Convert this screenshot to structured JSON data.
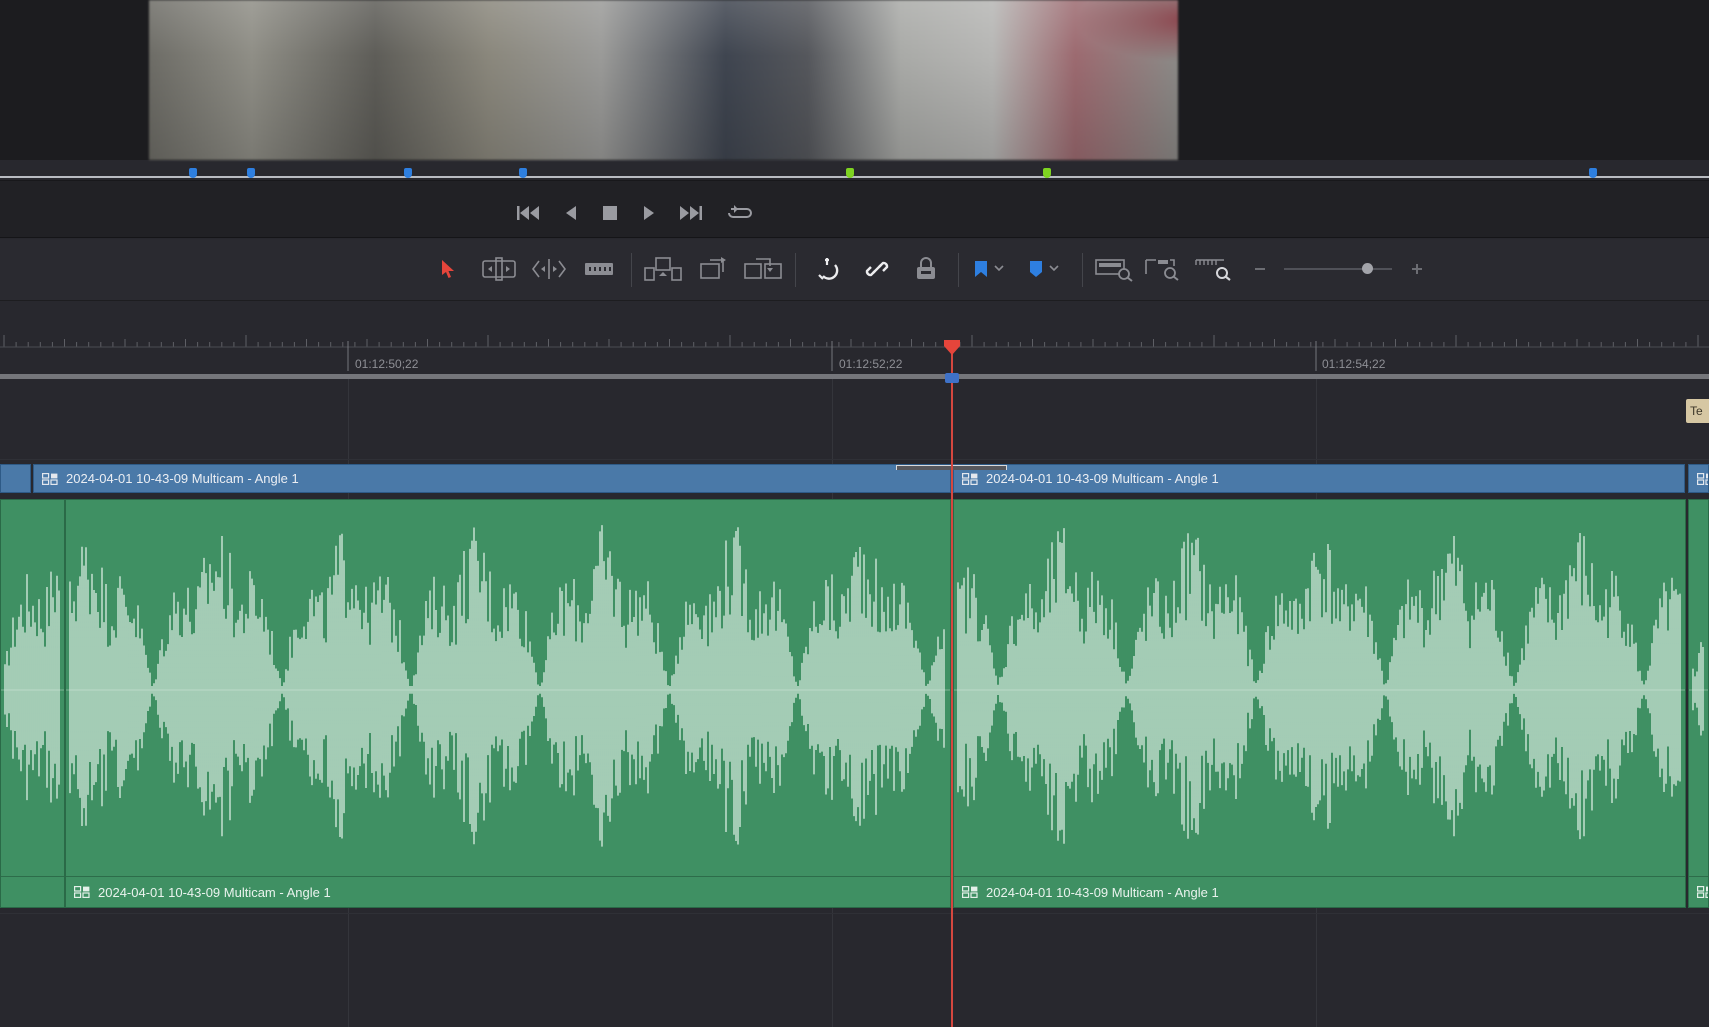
{
  "viewer": {
    "markers": [
      {
        "color": "#2e7fe0"
      },
      {
        "color": "#2e7fe0"
      },
      {
        "color": "#2e7fe0"
      },
      {
        "color": "#2e7fe0"
      },
      {
        "color": "#7ed321"
      },
      {
        "color": "#7ed321"
      },
      {
        "color": "#2e7fe0"
      }
    ]
  },
  "transport": {
    "buttons": [
      "skip-to-start-icon",
      "play-reverse-icon",
      "stop-icon",
      "play-icon",
      "skip-to-end-icon",
      "loop-icon"
    ]
  },
  "toolbar": {
    "tools": [
      "selection-mode-icon",
      "trim-edit-mode-icon",
      "dynamic-trim-mode-icon",
      "blade-edit-mode-icon",
      "insert-clip-icon",
      "overwrite-clip-icon",
      "replace-clip-icon",
      "snapping-icon",
      "linked-selection-icon",
      "position-lock-icon",
      "flag-icon",
      "marker-icon",
      "full-extent-zoom-icon",
      "detail-zoom-icon",
      "custom-zoom-icon"
    ],
    "accent_color": "#e5453b",
    "flag_color": "#2e7fe0",
    "marker_color": "#2e7fe0"
  },
  "ruler": {
    "timecodes": [
      "01:12:50;22",
      "01:12:52;22",
      "01:12:54;22"
    ]
  },
  "timeline": {
    "text_clip_label": "Te",
    "video_clips": [
      {
        "label": ""
      },
      {
        "label": "2024-04-01 10-43-09 Multicam - Angle 1"
      },
      {
        "label": "2024-04-01 10-43-09 Multicam - Angle 1"
      },
      {
        "label": ""
      }
    ],
    "audio_clips": [
      {
        "label": ""
      },
      {
        "label": "2024-04-01 10-43-09 Multicam - Angle 1"
      },
      {
        "label": "2024-04-01 10-43-09 Multicam - Angle 1"
      },
      {
        "label": ""
      }
    ],
    "playhead_color": "#d5473f",
    "video_clip_color": "#4a79a8",
    "audio_clip_color": "#3f9063"
  }
}
